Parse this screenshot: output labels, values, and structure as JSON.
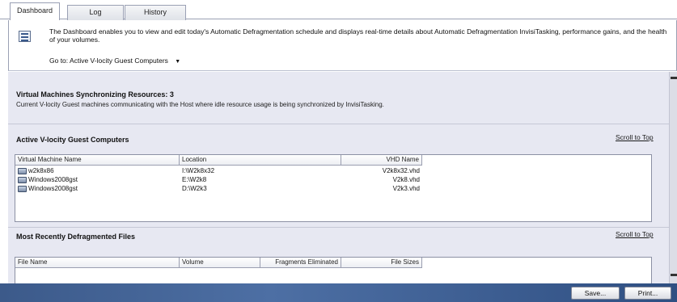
{
  "tabs": [
    {
      "label": "Dashboard",
      "active": true
    },
    {
      "label": "Log",
      "active": false
    },
    {
      "label": "History",
      "active": false
    }
  ],
  "info": {
    "description": "The Dashboard enables you to view and edit today's Automatic Defragmentation schedule and displays real-time details about Automatic Defragmentation InvisiTasking, performance gains, and the health of your volumes.",
    "goto_label": "Go to: Active V-locity Guest Computers",
    "goto_caret": "▼"
  },
  "sync": {
    "title": "Virtual Machines Synchronizing Resources: 3",
    "description": "Current V-locity Guest machines communicating with the Host where idle resource usage is being synchronized by InvisiTasking."
  },
  "guests": {
    "title": "Active V-locity Guest Computers",
    "scroll_to_top": "Scroll to Top",
    "columns": [
      "Virtual Machine Name",
      "Location",
      "VHD Name"
    ],
    "rows": [
      {
        "name": "w2k8x86",
        "location": "I:\\W2k8x32",
        "vhd": "V2k8x32.vhd"
      },
      {
        "name": "Windows2008gst",
        "location": "E:\\W2k8",
        "vhd": "V2k8.vhd"
      },
      {
        "name": "Windows2008gst",
        "location": "D:\\W2k3",
        "vhd": "V2k3.vhd"
      }
    ]
  },
  "files": {
    "title": "Most Recently Defragmented Files",
    "scroll_to_top": "Scroll to Top",
    "columns": [
      "File Name",
      "Volume",
      "Fragments Eliminated",
      "File Sizes"
    ]
  },
  "buttons": {
    "save": "Save...",
    "print": "Print..."
  }
}
